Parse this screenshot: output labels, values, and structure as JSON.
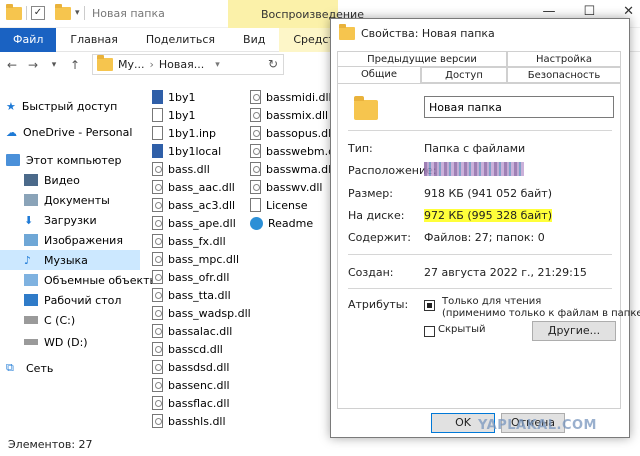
{
  "explorer": {
    "window_title": "Новая папка",
    "context_tab": "Воспроизведение",
    "ribbon_tabs": [
      "Файл",
      "Главная",
      "Поделиться",
      "Вид",
      "Средства работы с м"
    ],
    "address": {
      "root": "Му...",
      "current": "Новая..."
    },
    "sidebar": [
      {
        "label": "Быстрый доступ",
        "icon": "star-icon"
      },
      {
        "label": "OneDrive - Personal",
        "icon": "cloud-icon"
      },
      {
        "label": "Этот компьютер",
        "icon": "computer-icon"
      },
      {
        "label": "Видео",
        "icon": "video-folder-icon"
      },
      {
        "label": "Документы",
        "icon": "documents-folder-icon"
      },
      {
        "label": "Загрузки",
        "icon": "downloads-folder-icon"
      },
      {
        "label": "Изображения",
        "icon": "pictures-folder-icon"
      },
      {
        "label": "Музыка",
        "icon": "music-folder-icon"
      },
      {
        "label": "Объемные объекты",
        "icon": "3d-objects-icon"
      },
      {
        "label": "Рабочий стол",
        "icon": "desktop-folder-icon"
      },
      {
        "label": "C (C:)",
        "icon": "drive-icon"
      },
      {
        "label": "WD (D:)",
        "icon": "drive-icon"
      },
      {
        "label": "Сеть",
        "icon": "network-icon"
      }
    ],
    "files_col1": [
      {
        "name": "1by1",
        "type": "app"
      },
      {
        "name": "1by1",
        "type": "file"
      },
      {
        "name": "1by1.inp",
        "type": "file"
      },
      {
        "name": "1by1local",
        "type": "app"
      },
      {
        "name": "bass.dll",
        "type": "dll"
      },
      {
        "name": "bass_aac.dll",
        "type": "dll"
      },
      {
        "name": "bass_ac3.dll",
        "type": "dll"
      },
      {
        "name": "bass_ape.dll",
        "type": "dll"
      },
      {
        "name": "bass_fx.dll",
        "type": "dll"
      },
      {
        "name": "bass_mpc.dll",
        "type": "dll"
      },
      {
        "name": "bass_ofr.dll",
        "type": "dll"
      },
      {
        "name": "bass_tta.dll",
        "type": "dll"
      },
      {
        "name": "bass_wadsp.dll",
        "type": "dll"
      },
      {
        "name": "bassalac.dll",
        "type": "dll"
      },
      {
        "name": "basscd.dll",
        "type": "dll"
      },
      {
        "name": "bassdsd.dll",
        "type": "dll"
      },
      {
        "name": "bassenc.dll",
        "type": "dll"
      },
      {
        "name": "bassflac.dll",
        "type": "dll"
      },
      {
        "name": "basshls.dll",
        "type": "dll"
      }
    ],
    "files_col2": [
      {
        "name": "bassmidi.dll",
        "type": "dll"
      },
      {
        "name": "bassmix.dll",
        "type": "dll"
      },
      {
        "name": "bassopus.dll",
        "type": "dll"
      },
      {
        "name": "basswebm.dll",
        "type": "dll"
      },
      {
        "name": "basswma.dll",
        "type": "dll"
      },
      {
        "name": "basswv.dll",
        "type": "dll"
      },
      {
        "name": "License",
        "type": "file"
      },
      {
        "name": "Readme",
        "type": "readme"
      }
    ],
    "status": "Элементов: 27"
  },
  "dialog": {
    "title": "Свойства: Новая папка",
    "tabs_row1": [
      "Предыдущие версии",
      "Настройка"
    ],
    "tabs_row2": [
      "Общие",
      "Доступ",
      "Безопасность"
    ],
    "folder_name": "Новая папка",
    "type_label": "Тип:",
    "type_value": "Папка с файлами",
    "location_label": "Расположение:",
    "size_label": "Размер:",
    "size_value": "918 КБ (941 052 байт)",
    "disk_label": "На диске:",
    "disk_value": "972 КБ (995 328 байт)",
    "contains_label": "Содержит:",
    "contains_value": "Файлов: 27; папок: 0",
    "created_label": "Создан:",
    "created_value": "27 августа 2022 г., 21:29:15",
    "attributes_label": "Атрибуты:",
    "readonly_label": "Только для чтения",
    "readonly_note": "(применимо только к файлам в папке)",
    "hidden_label": "Скрытый",
    "other_button": "Другие...",
    "ok_button": "OK",
    "cancel_button": "Отмена"
  },
  "watermark": "YAPLAKAL.COM"
}
